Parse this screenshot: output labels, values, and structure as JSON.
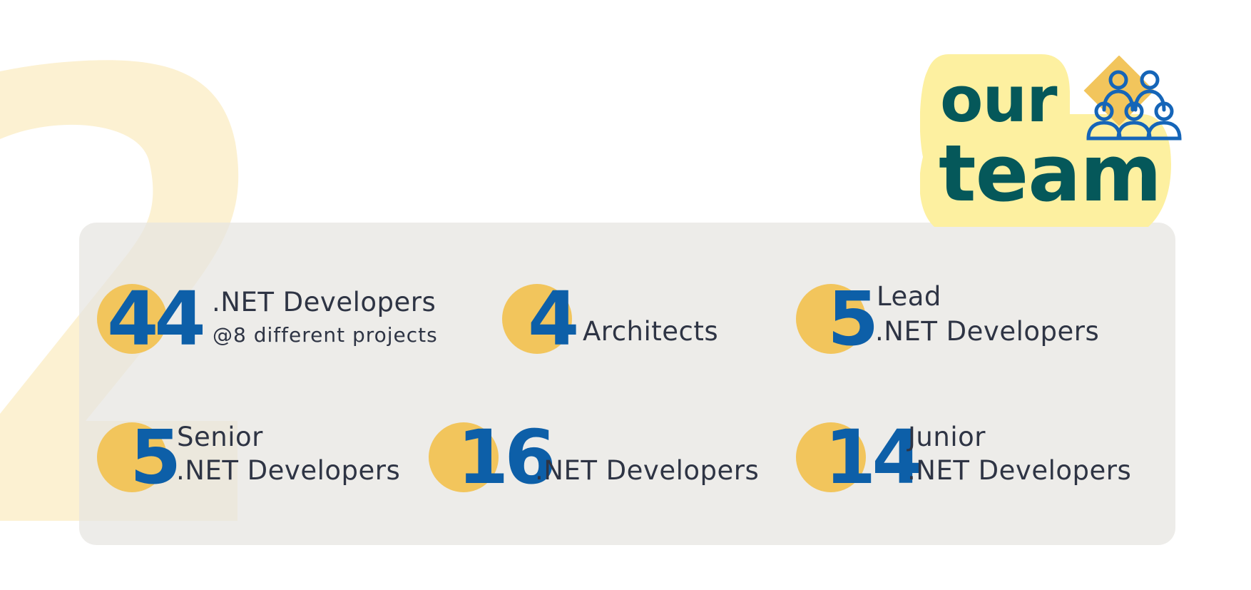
{
  "colors": {
    "number_blue": "#0d5fa8",
    "circle_yellow": "#f2c55c",
    "title_teal": "#05585a",
    "title_highlight": "#fdf0a0",
    "panel_gray": "#e6e5e1",
    "label_dark": "#2e3444"
  },
  "header": {
    "title_line1": "our",
    "title_line2": "team",
    "icon": "team-people-icon"
  },
  "background_numeral": "2",
  "stats": [
    {
      "number": "44",
      "line1": ".NET Developers",
      "line2": "@8 different projects"
    },
    {
      "number": "4",
      "line1": "Architects"
    },
    {
      "number": "5",
      "line1": "Lead",
      "line2": ".NET Developers"
    },
    {
      "number": "5",
      "line1": "Senior",
      "line2": ".NET Developers"
    },
    {
      "number": "16",
      "line1": ".NET Developers"
    },
    {
      "number": "14",
      "line1": "Junior",
      "line2": ".NET Developers"
    }
  ]
}
